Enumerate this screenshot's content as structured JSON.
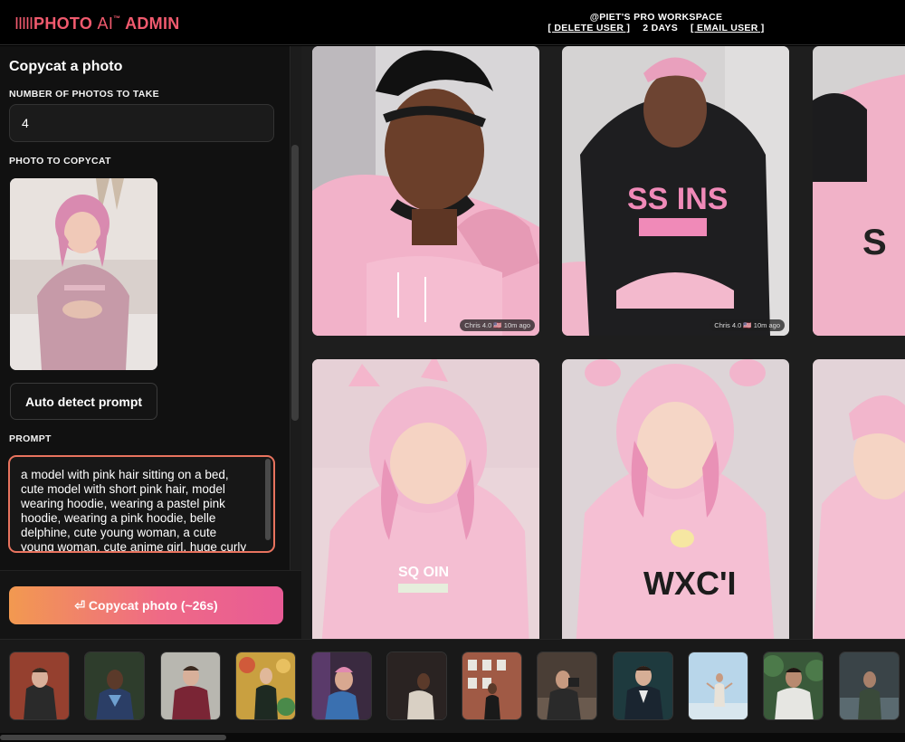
{
  "header": {
    "logo_bars": "IIIII",
    "logo_photo": "PHOTO",
    "logo_ai": "AI",
    "logo_tm": "™",
    "logo_admin": "ADMIN",
    "workspace_title": "@PIET'S PRO WORKSPACE",
    "delete_user": "[ DELETE USER ]",
    "days": "2 DAYS",
    "email_user": "[ EMAIL USER ]"
  },
  "sidebar": {
    "title": "Copycat a photo",
    "num_photos_label": "NUMBER OF PHOTOS TO TAKE",
    "num_photos_value": "4",
    "photo_label": "PHOTO TO COPYCAT",
    "auto_detect_label": "Auto detect prompt",
    "prompt_label": "PROMPT",
    "prompt_text": "a model with pink hair sitting on a bed, cute model with short pink hair, model wearing hoodie, wearing a pastel pink hoodie, wearing a pink hoodie, belle delphine, cute young woman, a cute young woman, cute anime girl, huge curly",
    "copycat_button": "⏎ Copycat photo (~26s)"
  },
  "gallery": {
    "cards": [
      {
        "badge": "Chris 4.0 🇺🇸 10m ago",
        "hoodie_text": ""
      },
      {
        "badge": "Chris 4.0 🇺🇸 10m ago",
        "hoodie_text": "SS INS"
      },
      {
        "badge": "",
        "hoodie_text": "S"
      },
      {
        "badge": "",
        "hoodie_text": "SQ OIN"
      },
      {
        "badge": "",
        "hoodie_text": "WXC'I"
      },
      {
        "badge": "",
        "hoodie_text": ""
      }
    ]
  },
  "colors": {
    "brand": "#f05a6e",
    "accent_gradient_start": "#f29950",
    "accent_gradient_end": "#e85b95",
    "prompt_border": "#e8735e",
    "pink_hoodie": "#f4b8cc"
  },
  "icons": [
    "return-icon"
  ]
}
